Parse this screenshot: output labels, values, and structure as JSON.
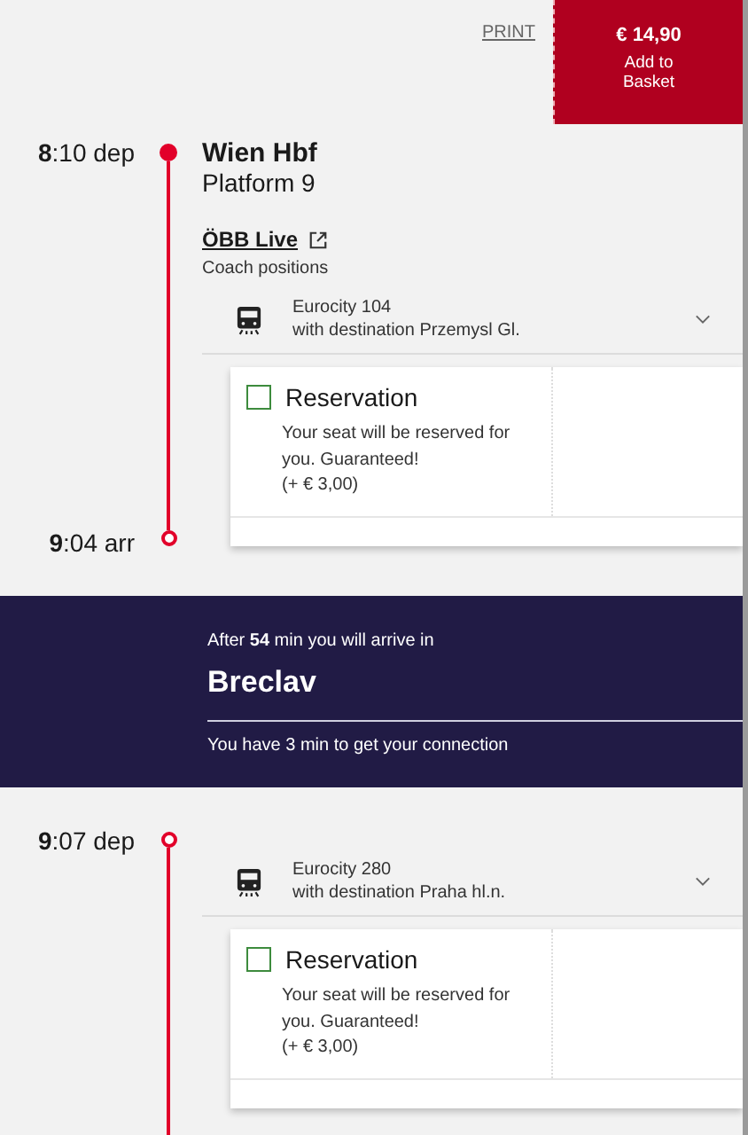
{
  "header": {
    "print_link": "PRINT",
    "price": "€ 14,90",
    "basket_label": "Add to Basket"
  },
  "legs": [
    {
      "departure": {
        "time": "**8**:10 dep",
        "filled": true
      },
      "station": {
        "name": "Wien Hbf",
        "platform": "Platform  9"
      },
      "live_link": "ÖBB Live",
      "live_caption": "Coach positions",
      "train": {
        "name": "Eurocity 104",
        "destination": "with destination Przemysl Gl.",
        "expanded": false
      },
      "reservation": {
        "title": "Reservation",
        "checked": false,
        "description": "Your seat will be reserved for you. Guaranteed!",
        "price": "(+  € 3,00)"
      },
      "arrival": {
        "time": "**9**:04 arr",
        "filled": false
      }
    },
    {
      "departure": {
        "time": "**9**:07 dep",
        "filled": false
      },
      "train": {
        "name": "Eurocity 280",
        "destination": "with destination Praha hl.n.",
        "expanded": false
      },
      "reservation": {
        "title": "Reservation",
        "checked": false,
        "description": "Your seat will be reserved for you. Guaranteed!",
        "price": "(+  € 3,00)"
      }
    }
  ],
  "transfer": {
    "intro": "After **54** min you will arrive in",
    "station": "Breclav",
    "connection_note": "You have 3 min to get your connection"
  }
}
